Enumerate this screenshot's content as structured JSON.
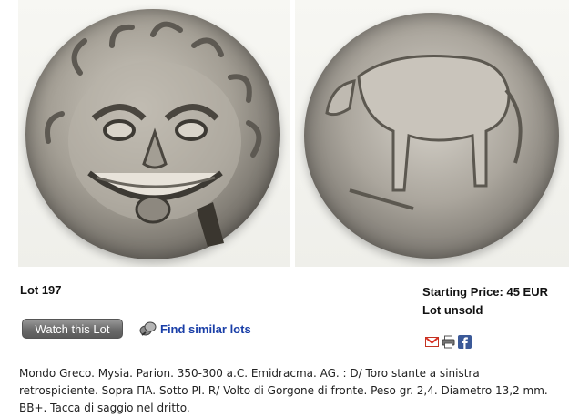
{
  "lot": {
    "label": "Lot 197"
  },
  "price": {
    "starting": "Starting Price: 45 EUR",
    "status": "Lot unsold"
  },
  "actions": {
    "watch_label": "Watch this Lot",
    "similar_label": "Find similar lots"
  },
  "share": {
    "icons": [
      "gmail-icon",
      "print-icon",
      "facebook-icon"
    ]
  },
  "description": "Mondo Greco. Mysia. Parion. 350-300 a.C. Emidracma. AG. : D/ Toro stante a sinistra retrospiciente. Sopra ΠA. Sotto PI. R/ Volto di Gorgone di fronte. Peso gr. 2,4. Diametro 13,2 mm. BB+. Tacca di saggio nel dritto.",
  "colors": {
    "link": "#1a3fa8",
    "button": "#6b6b6b",
    "text": "#222222"
  }
}
